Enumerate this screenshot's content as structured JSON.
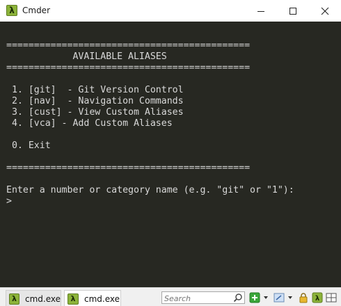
{
  "window": {
    "title": "Cmder",
    "app_icon_glyph": "λ"
  },
  "console": {
    "lines": [
      "============================================",
      "            AVAILABLE ALIASES",
      "============================================",
      "",
      " 1. [git]  - Git Version Control",
      " 2. [nav]  - Navigation Commands",
      " 3. [cust] - View Custom Aliases",
      " 4. [vca] - Add Custom Aliases",
      "",
      " 0. Exit",
      "",
      "============================================",
      "",
      "Enter a number or category name (e.g. \"git\" or \"1\"):",
      ">"
    ]
  },
  "statusbar": {
    "tabs": [
      {
        "label": "cmd.exe",
        "icon": "λ"
      },
      {
        "label": "cmd.exe",
        "icon": "λ"
      }
    ],
    "search": {
      "placeholder": "Search",
      "value": ""
    }
  },
  "colors": {
    "console_bg": "#272822",
    "console_fg": "#d8d8d8",
    "lambda_green": "#8cb33a"
  }
}
